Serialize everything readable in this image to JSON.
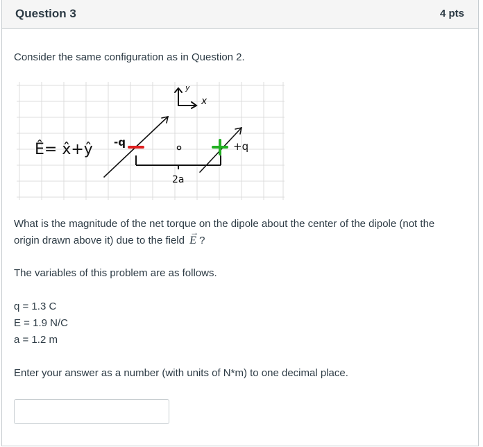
{
  "question": {
    "title": "Question 3",
    "points": "4 pts"
  },
  "body": {
    "intro": "Consider the same configuration as in Question 2.",
    "prompt_line1": "What is the magnitude of the net torque on the dipole about the center of the dipole (not the",
    "prompt_line2_before": "origin drawn above it) due to the field",
    "field_symbol": "E",
    "prompt_line2_after": "?",
    "variables_intro": "The variables of this problem are as follows.",
    "variables": [
      "q = 1.3 C",
      "E = 1.9 N/C",
      "a = 1.2 m"
    ],
    "instructions": "Enter your answer as a number (with units of N*m) to one decimal place."
  },
  "figure": {
    "field_label": "Ê= x̂+ŷ",
    "neg_charge_label": "-q",
    "pos_charge_label": "+q",
    "separation_label": "2a",
    "axis_y_label": "y",
    "axis_x_label": "x",
    "neg_color": "#e02020",
    "pos_color": "#22b022"
  },
  "answer": {
    "value": ""
  }
}
